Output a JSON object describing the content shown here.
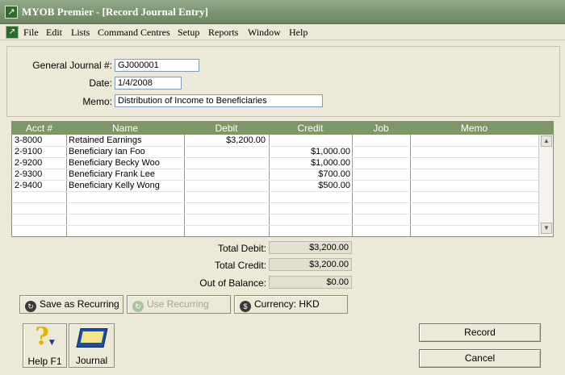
{
  "window": {
    "title": "MYOB Premier - [Record Journal Entry]"
  },
  "menu": [
    "File",
    "Edit",
    "Lists",
    "Command Centres",
    "Setup",
    "Reports",
    "Window",
    "Help"
  ],
  "form": {
    "journal_label": "General Journal #:",
    "journal_value": "GJ000001",
    "date_label": "Date:",
    "date_value": "1/4/2008",
    "memo_label": "Memo:",
    "memo_value": "Distribution of Income to Beneficiaries"
  },
  "grid": {
    "columns": [
      "Acct #",
      "Name",
      "Debit",
      "Credit",
      "Job",
      "Memo"
    ],
    "rows": [
      {
        "acct": "3-8000",
        "name": "Retained Earnings",
        "debit": "$3,200.00",
        "credit": "",
        "job": "",
        "memo": ""
      },
      {
        "acct": "2-9100",
        "name": "Beneficiary Ian Foo",
        "debit": "",
        "credit": "$1,000.00",
        "job": "",
        "memo": ""
      },
      {
        "acct": "2-9200",
        "name": "Beneficiary Becky Woo",
        "debit": "",
        "credit": "$1,000.00",
        "job": "",
        "memo": ""
      },
      {
        "acct": "2-9300",
        "name": "Beneficiary Frank Lee",
        "debit": "",
        "credit": "$700.00",
        "job": "",
        "memo": ""
      },
      {
        "acct": "2-9400",
        "name": "Beneficiary Kelly Wong",
        "debit": "",
        "credit": "$500.00",
        "job": "",
        "memo": ""
      }
    ]
  },
  "totals": {
    "debit_label": "Total Debit:",
    "debit_value": "$3,200.00",
    "credit_label": "Total Credit:",
    "credit_value": "$3,200.00",
    "balance_label": "Out of Balance:",
    "balance_value": "$0.00"
  },
  "buttons": {
    "save_recurring": "Save as Recurring",
    "use_recurring": "Use Recurring",
    "currency": "Currency:  HKD",
    "help": "Help F1",
    "journal": "Journal",
    "record": "Record",
    "cancel": "Cancel"
  },
  "colors": {
    "title_bar": "#7c9570",
    "grid_header": "#7d9867",
    "background": "#ece9d8"
  },
  "icons": [
    "app-icon",
    "save-recurring-icon",
    "use-recurring-icon",
    "currency-icon",
    "help-question-icon",
    "journal-book-icon",
    "scroll-up-icon",
    "scroll-down-icon"
  ]
}
